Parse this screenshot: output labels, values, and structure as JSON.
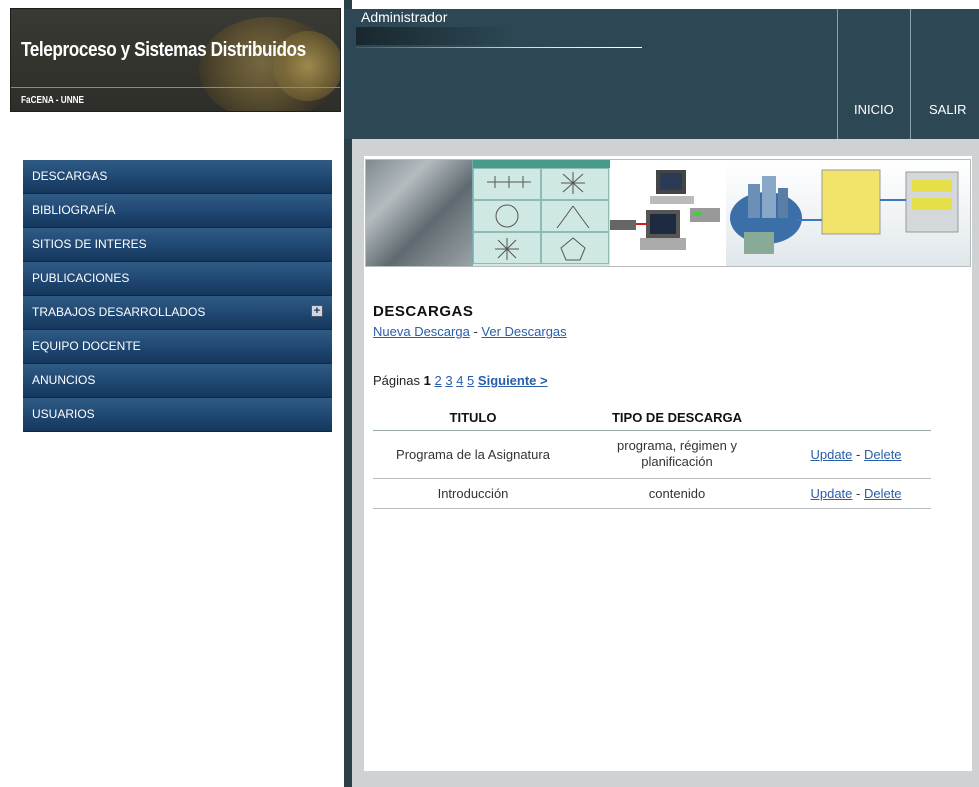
{
  "site": {
    "title": "Teleproceso y Sistemas Distribuidos",
    "subtitle": "FaCENA - UNNE"
  },
  "sidebar": {
    "items": [
      {
        "label": "DESCARGAS"
      },
      {
        "label": "BIBLIOGRAFÍA"
      },
      {
        "label": "SITIOS DE INTERES"
      },
      {
        "label": "PUBLICACIONES"
      },
      {
        "label": "TRABAJOS DESARROLLADOS",
        "expandable": true
      },
      {
        "label": "EQUIPO DOCENTE"
      },
      {
        "label": "ANUNCIOS"
      },
      {
        "label": "USUARIOS"
      }
    ]
  },
  "header": {
    "user": "Administrador",
    "nav": {
      "home": "INICIO",
      "logout": "SALIR"
    }
  },
  "main": {
    "title": "DESCARGAS",
    "links": {
      "new": "Nueva Descarga",
      "separator": " - ",
      "view": "Ver Descargas"
    },
    "pager": {
      "prefix": "Páginas",
      "current": "1",
      "pages": [
        "2",
        "3",
        "4",
        "5"
      ],
      "next": "Siguiente >"
    },
    "table": {
      "headers": [
        "TITULO",
        "TIPO DE DESCARGA",
        ""
      ],
      "rows": [
        {
          "titulo": "Programa de la Asignatura",
          "tipo": "programa, régimen y planificación",
          "update": "Update",
          "sep": " - ",
          "delete": "Delete"
        },
        {
          "titulo": "Introducción",
          "tipo": "contenido",
          "update": "Update",
          "sep": " - ",
          "delete": "Delete"
        }
      ]
    }
  },
  "colors": {
    "menu": "#1f4772",
    "topbar": "#2d4854",
    "link": "#2a5ea8"
  }
}
